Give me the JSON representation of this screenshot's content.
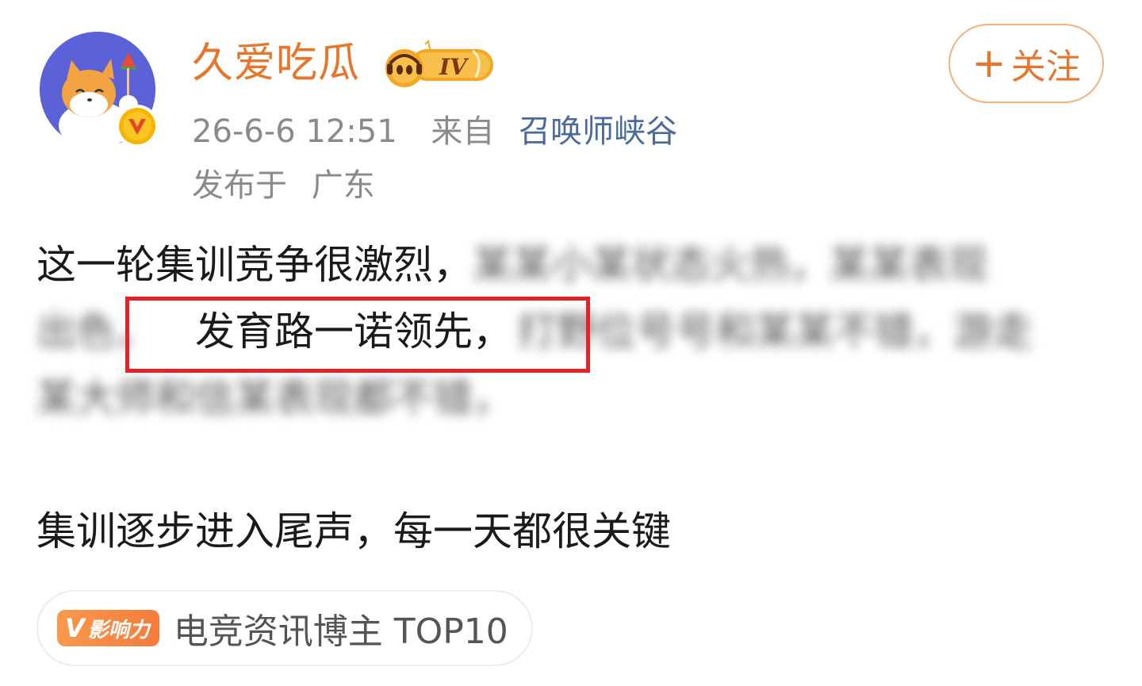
{
  "header": {
    "username": "久爱吃瓜",
    "level_badge": "IV",
    "time": "26-6-6 12:51",
    "source_prefix": "来自",
    "source": "召唤师峡谷",
    "location_prefix": "发布于",
    "location": "广东",
    "follow_plus": "+",
    "follow_label": "关注"
  },
  "post": {
    "line1_visible": "这一轮集训竞争很激烈，",
    "line1_blurred": "某某小某状态火热，某某表现",
    "line2_blurred_start": "出色，",
    "line2_highlight": "发育路一诺领先，",
    "line2_blurred_end": "打野位号号和某某不错，游走",
    "line3_blurred": "某大师和信某表现都不错，",
    "line4": "集训逐步进入尾声，每一天都很关键"
  },
  "influence": {
    "badge_v": "V",
    "badge_label": "影响力",
    "text": "电竞资讯博主 TOP10"
  },
  "colors": {
    "username": "#e8762a",
    "source_link": "#4a6a9c",
    "highlight_border": "#e8202a",
    "avatar_bg": "#5b62d8",
    "badge_orange": "#f47b3c"
  },
  "icons": {
    "avatar": "shiba-dog-avatar",
    "verified": "orange-v-verified-icon",
    "level": "music-level-badge-icon"
  }
}
